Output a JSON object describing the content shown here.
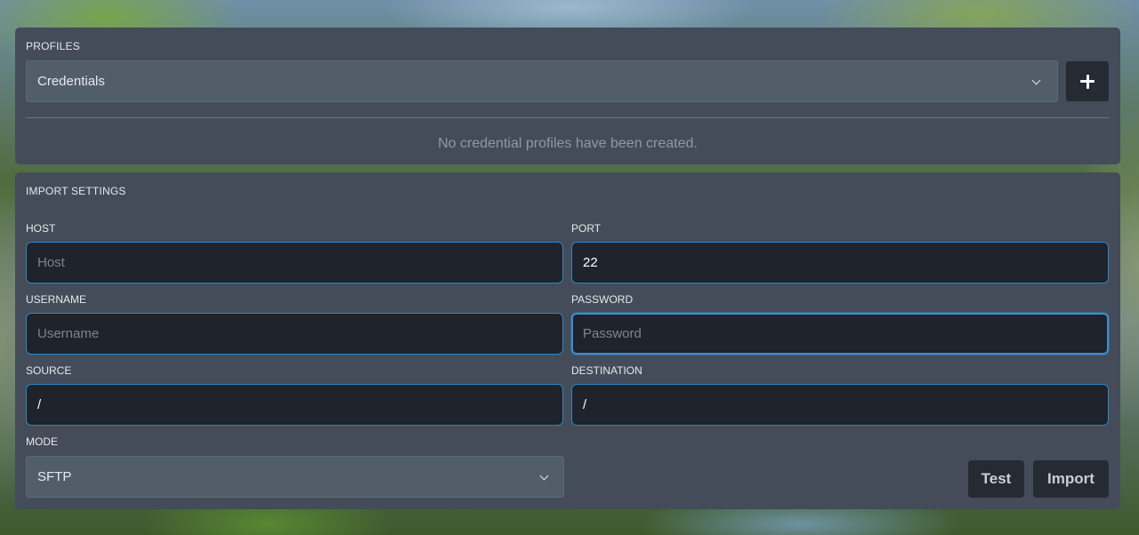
{
  "profiles": {
    "title": "PROFILES",
    "select_value": "Credentials",
    "empty_message": "No credential profiles have been created."
  },
  "import_settings": {
    "title": "IMPORT SETTINGS",
    "host": {
      "label": "HOST",
      "value": "",
      "placeholder": "Host"
    },
    "port": {
      "label": "PORT",
      "value": "22",
      "placeholder": ""
    },
    "username": {
      "label": "USERNAME",
      "value": "",
      "placeholder": "Username"
    },
    "password": {
      "label": "PASSWORD",
      "value": "",
      "placeholder": "Password"
    },
    "source": {
      "label": "SOURCE",
      "value": "/",
      "placeholder": ""
    },
    "destination": {
      "label": "DESTINATION",
      "value": "/",
      "placeholder": ""
    },
    "mode": {
      "label": "MODE",
      "value": "SFTP"
    },
    "test_label": "Test",
    "import_label": "Import"
  },
  "colors": {
    "panel": "#434c58",
    "input_bg": "#1f232b",
    "input_border": "#2f86c6",
    "button_bg": "#252a33"
  },
  "icons": {
    "add": "plus-icon",
    "dropdown": "chevron-down-icon"
  }
}
